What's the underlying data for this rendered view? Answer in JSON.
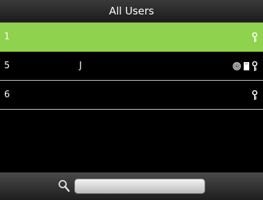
{
  "header": {
    "title": "All Users"
  },
  "users": [
    {
      "id": "1",
      "name": "",
      "selected": true,
      "icons": [
        "key-icon"
      ]
    },
    {
      "id": "5",
      "name": "J",
      "selected": false,
      "icons": [
        "fingerprint-icon",
        "card-icon",
        "key-icon"
      ]
    },
    {
      "id": "6",
      "name": "",
      "selected": false,
      "icons": [
        "key-icon"
      ]
    }
  ],
  "search": {
    "icon": "search-icon",
    "value": "",
    "placeholder": ""
  },
  "colors": {
    "selected_row": "#8fd24d",
    "background": "#000000",
    "divider": "#d0d0d0"
  }
}
